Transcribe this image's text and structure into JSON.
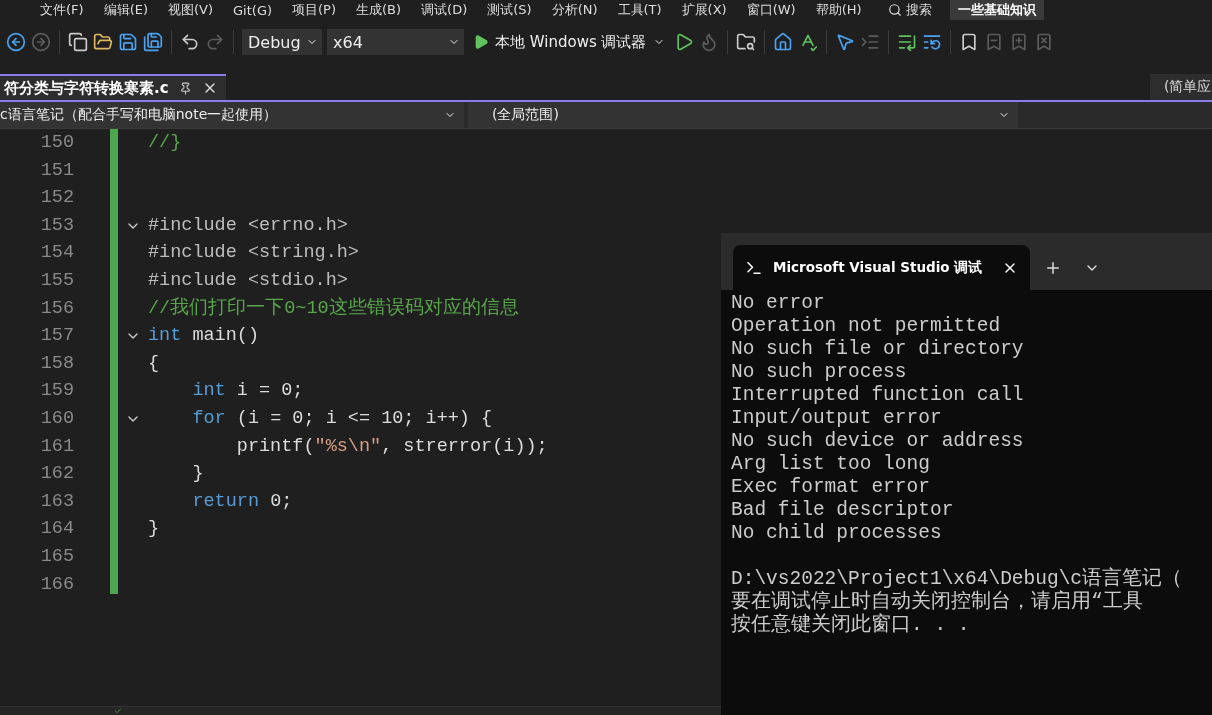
{
  "menu": [
    "文件(F)",
    "编辑(E)",
    "视图(V)",
    "Git(G)",
    "项目(P)",
    "生成(B)",
    "调试(D)",
    "测试(S)",
    "分析(N)",
    "工具(T)",
    "扩展(X)",
    "窗口(W)",
    "帮助(H)"
  ],
  "search": {
    "label": "搜索"
  },
  "solution_title": "一些基础知识",
  "toolbar": [
    {
      "kind": "back",
      "disabled": false
    },
    {
      "kind": "forward",
      "disabled": true
    },
    {
      "kind": "sep"
    },
    {
      "kind": "new",
      "disabled": false
    },
    {
      "kind": "open",
      "disabled": false
    },
    {
      "kind": "save",
      "disabled": false
    },
    {
      "kind": "saveall",
      "disabled": false
    },
    {
      "kind": "sep"
    },
    {
      "kind": "undo",
      "disabled": false
    },
    {
      "kind": "redo",
      "disabled": true
    }
  ],
  "configuration": "Debug",
  "platform": "x64",
  "run_button": "本地 Windows 调试器",
  "toolbar_right": [
    {
      "kind": "play",
      "disabled": false
    },
    {
      "kind": "flame",
      "disabled": true
    },
    {
      "kind": "sep"
    },
    {
      "kind": "find",
      "disabled": false
    },
    {
      "kind": "sep"
    },
    {
      "kind": "home",
      "disabled": false
    },
    {
      "kind": "spell",
      "disabled": false
    },
    {
      "kind": "sep"
    },
    {
      "kind": "pointer",
      "disabled": false
    },
    {
      "kind": "indent",
      "disabled": true
    },
    {
      "kind": "sep"
    },
    {
      "kind": "comment",
      "disabled": false
    },
    {
      "kind": "uncomment",
      "disabled": false
    },
    {
      "kind": "sep"
    },
    {
      "kind": "bookmark",
      "disabled": false
    },
    {
      "kind": "bookmark-prev",
      "disabled": true
    },
    {
      "kind": "bookmark-next",
      "disabled": true
    },
    {
      "kind": "bookmark-clear",
      "disabled": true
    }
  ],
  "document_tab": {
    "title": "符分类与字符转换寒素.c",
    "selected": true
  },
  "side_tab": "(简单应",
  "nav": {
    "project": "c语言笔记（配合手写和电脑note一起使用）",
    "scope": "(全局范围)"
  },
  "code_lines": [
    {
      "number": "150",
      "segments": [
        {
          "kind": "comment",
          "text": "//}"
        }
      ]
    },
    {
      "number": "151"
    },
    {
      "number": "152"
    },
    {
      "number": "153",
      "fold": true,
      "segments": [
        {
          "kind": "preproc",
          "text": "#include <errno.h>"
        }
      ]
    },
    {
      "number": "154",
      "segments": [
        {
          "kind": "preproc",
          "text": "#include <string.h>"
        }
      ]
    },
    {
      "number": "155",
      "segments": [
        {
          "kind": "preproc",
          "text": "#include <stdio.h>"
        }
      ]
    },
    {
      "number": "156",
      "segments": [
        {
          "kind": "comment",
          "text": "//我们打印一下0~10这些错误码对应的信息"
        }
      ]
    },
    {
      "number": "157",
      "fold": true,
      "segments": [
        {
          "kind": "keyword",
          "text": "int"
        },
        {
          "kind": "plain",
          "text": " main()"
        }
      ]
    },
    {
      "number": "158",
      "segments": [
        {
          "kind": "plain",
          "text": "{"
        }
      ]
    },
    {
      "number": "159",
      "segments": [
        {
          "kind": "keyword",
          "text": "    int"
        },
        {
          "kind": "plain",
          "text": " i = 0;"
        }
      ]
    },
    {
      "number": "160",
      "fold": true,
      "segments": [
        {
          "kind": "keyword",
          "text": "    for"
        },
        {
          "kind": "plain",
          "text": " (i = 0; i <= 10; i++) {"
        }
      ]
    },
    {
      "number": "161",
      "segments": [
        {
          "kind": "plain",
          "text": "        printf("
        },
        {
          "kind": "string",
          "text": "\"%s\\n\""
        },
        {
          "kind": "plain",
          "text": ", strerror(i));"
        }
      ]
    },
    {
      "number": "162",
      "segments": [
        {
          "kind": "plain",
          "text": "    }"
        }
      ]
    },
    {
      "number": "163",
      "segments": [
        {
          "kind": "keyword",
          "text": "    return"
        },
        {
          "kind": "plain",
          "text": " 0;"
        }
      ]
    },
    {
      "number": "164",
      "segments": [
        {
          "kind": "plain",
          "text": "}"
        }
      ]
    },
    {
      "number": "165"
    },
    {
      "number": "166"
    }
  ],
  "console": {
    "tab_title": "Microsoft Visual Studio 调试",
    "lines": [
      "No error",
      "Operation not permitted",
      "No such file or directory",
      "No such process",
      "Interrupted function call",
      "Input/output error",
      "No such device or address",
      "Arg list too long",
      "Exec format error",
      "Bad file descriptor",
      "No child processes"
    ],
    "footer": [
      "D:\\vs2022\\Project1\\x64\\Debug\\c语言笔记（",
      "要在调试停止时自动关闭控制台，请启用“工具",
      "按任意键关闭此窗口. . ."
    ]
  }
}
